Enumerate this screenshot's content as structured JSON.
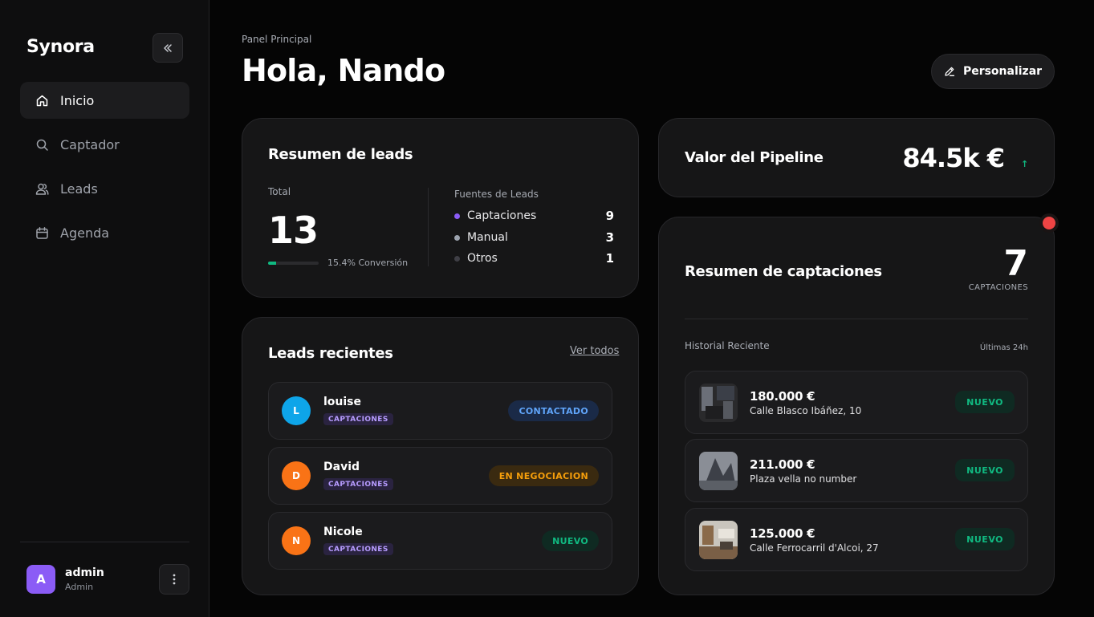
{
  "app": {
    "name": "Synora"
  },
  "sidebar": {
    "items": [
      {
        "label": "Inicio",
        "icon": "home-icon"
      },
      {
        "label": "Captador",
        "icon": "search-icon"
      },
      {
        "label": "Leads",
        "icon": "users-icon"
      },
      {
        "label": "Agenda",
        "icon": "calendar-icon"
      }
    ],
    "user": {
      "initial": "A",
      "name": "admin",
      "role": "Admin"
    }
  },
  "header": {
    "breadcrumb": "Panel Principal",
    "title": "Hola, Nando",
    "customize_label": "Personalizar"
  },
  "leads_summary": {
    "title": "Resumen de leads",
    "total_label": "Total",
    "total": "13",
    "conversion_text": "15.4% Conversión",
    "conversion_pct": 15.4,
    "sources_title": "Fuentes de Leads",
    "sources": [
      {
        "label": "Captaciones",
        "count": "9",
        "color": "#8b5cf6"
      },
      {
        "label": "Manual",
        "count": "3",
        "color": "#9ca3af"
      },
      {
        "label": "Otros",
        "count": "1",
        "color": "#3f3f46"
      }
    ]
  },
  "recent_leads": {
    "title": "Leads recientes",
    "see_all": "Ver todos",
    "items": [
      {
        "initial": "L",
        "name": "louise",
        "tag": "CAPTACIONES",
        "status": "CONTACTADO",
        "avatar_color": "#0ea5e9",
        "status_bg": "#1a2a47",
        "status_color": "#60a5fa"
      },
      {
        "initial": "D",
        "name": "David",
        "tag": "CAPTACIONES",
        "status": "EN NEGOCIACION",
        "avatar_color": "#f97316",
        "status_bg": "#3a2a10",
        "status_color": "#f59e0b"
      },
      {
        "initial": "N",
        "name": "Nicole",
        "tag": "CAPTACIONES",
        "status": "NUEVO",
        "avatar_color": "#f97316",
        "status_bg": "#0f2a22",
        "status_color": "#10b981"
      }
    ]
  },
  "pipeline": {
    "title": "Valor del Pipeline",
    "value": "84.5k €",
    "trend": "↑"
  },
  "captaciones": {
    "title": "Resumen de captaciones",
    "count": "7",
    "count_label": "CAPTACIONES",
    "history_label": "Historial Reciente",
    "history_range": "Últimas 24h",
    "items": [
      {
        "price": "180.000 €",
        "address": "Calle Blasco Ibáñez, 10",
        "status": "NUEVO"
      },
      {
        "price": "211.000 €",
        "address": "Plaza vella no number",
        "status": "NUEVO"
      },
      {
        "price": "125.000 €",
        "address": "Calle Ferrocarril d'Alcoi, 27",
        "status": "NUEVO"
      }
    ]
  },
  "colors": {
    "accent": "#8b5cf6",
    "success": "#10b981",
    "danger": "#ef4444"
  }
}
